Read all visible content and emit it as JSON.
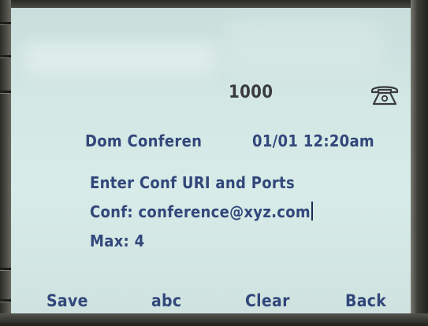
{
  "header": {
    "line_number": "1000",
    "phone_icon": "phone-handset-icon"
  },
  "status": {
    "title": "Dom Conferen",
    "datetime": "01/01 12:20am"
  },
  "form": {
    "prompt": "Enter Conf URI and Ports",
    "conf_label": "Conf:",
    "conf_value": "conference@xyz.com",
    "max_label": "Max:",
    "max_value": "4"
  },
  "softkeys": {
    "save": "Save",
    "abc": "abc",
    "clear": "Clear",
    "back": "Back"
  },
  "colors": {
    "screen_bg": "#d3e7e4",
    "text": "#32477a",
    "bezel": "#3a3a35"
  }
}
